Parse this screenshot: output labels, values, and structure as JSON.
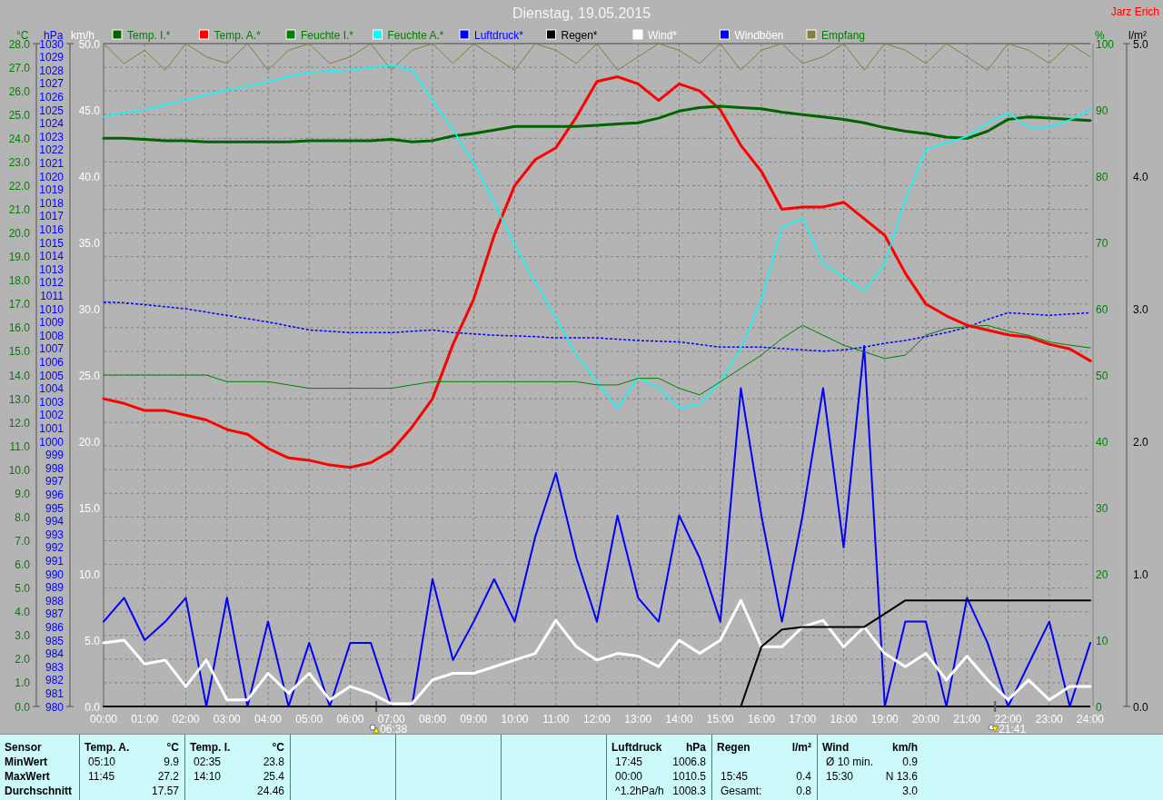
{
  "header": {
    "title": "Dienstag, 19.05.2015",
    "author": "Jarz Erich"
  },
  "charts": [
    {
      "chart_data": {
        "type": "line",
        "ylabel": "°C",
        "grid": true,
        "legend": "top",
        "x": [
          0,
          0.5,
          1,
          1.5,
          2,
          2.5,
          3,
          3.5,
          4,
          4.5,
          5,
          5.5,
          6,
          6.5,
          7,
          7.5,
          8,
          8.5,
          9,
          9.5,
          10,
          10.5,
          11,
          11.5,
          12,
          12.5,
          13,
          13.5,
          14,
          14.5,
          15,
          15.5,
          16,
          16.5,
          17,
          17.5,
          18,
          18.5,
          19,
          19.5,
          20,
          20.5,
          21,
          21.5,
          22,
          22.5,
          23,
          23.5,
          24
        ],
        "xlim": [
          0,
          24
        ],
        "xticks": [
          {
            "value": 0,
            "label": "00:00"
          },
          {
            "value": 1,
            "label": "01:00"
          },
          {
            "value": 2,
            "label": "02:00"
          },
          {
            "value": 3,
            "label": "03:00"
          },
          {
            "value": 4,
            "label": "04:00"
          },
          {
            "value": 5,
            "label": "05:00"
          },
          {
            "value": 6,
            "label": "06:00"
          },
          {
            "value": 7,
            "label": "07:00"
          },
          {
            "value": 8,
            "label": "08:00"
          },
          {
            "value": 9,
            "label": "09:00"
          },
          {
            "value": 10,
            "label": "10:00"
          },
          {
            "value": 11,
            "label": "11:00"
          },
          {
            "value": 12,
            "label": "12:00"
          },
          {
            "value": 13,
            "label": "13:00"
          },
          {
            "value": 14,
            "label": "14:00"
          },
          {
            "value": 15,
            "label": "15:00"
          },
          {
            "value": 16,
            "label": "16:00"
          },
          {
            "value": 17,
            "label": "17:00"
          },
          {
            "value": 18,
            "label": "18:00"
          },
          {
            "value": 19,
            "label": "19:00"
          },
          {
            "value": 20,
            "label": "20:00"
          },
          {
            "value": 21,
            "label": "21:00"
          },
          {
            "value": 22,
            "label": "22:00"
          },
          {
            "value": 23,
            "label": "23:00"
          },
          {
            "value": 24,
            "label": "24:00"
          }
        ],
        "ylim": [
          0,
          28
        ],
        "yticks": [
          {
            "value": 0,
            "label": "0.0"
          },
          {
            "value": 1,
            "label": "1.0"
          },
          {
            "value": 2,
            "label": "2.0"
          },
          {
            "value": 3,
            "label": "3.0"
          },
          {
            "value": 4,
            "label": "4.0"
          },
          {
            "value": 5,
            "label": "5.0"
          },
          {
            "value": 6,
            "label": "6.0"
          },
          {
            "value": 7,
            "label": "7.0"
          },
          {
            "value": 8,
            "label": "8.0"
          },
          {
            "value": 9,
            "label": "9.0"
          },
          {
            "value": 10,
            "label": "10.0"
          },
          {
            "value": 11,
            "label": "11.0"
          },
          {
            "value": 12,
            "label": "12.0"
          },
          {
            "value": 13,
            "label": "13.0"
          },
          {
            "value": 14,
            "label": "14.0"
          },
          {
            "value": 15,
            "label": "15.0"
          },
          {
            "value": 16,
            "label": "16.0"
          },
          {
            "value": 17,
            "label": "17.0"
          },
          {
            "value": 18,
            "label": "18.0"
          },
          {
            "value": 19,
            "label": "19.0"
          },
          {
            "value": 20,
            "label": "20.0"
          },
          {
            "value": 21,
            "label": "21.0"
          },
          {
            "value": 22,
            "label": "22.0"
          },
          {
            "value": 23,
            "label": "23.0"
          },
          {
            "value": 24,
            "label": "24.0"
          },
          {
            "value": 25,
            "label": "25.0"
          },
          {
            "value": 26,
            "label": "26.0"
          },
          {
            "value": 27,
            "label": "27.0"
          },
          {
            "value": 28,
            "label": "28.0"
          }
        ],
        "y2label": "hPa",
        "y2lim": [
          980,
          1030
        ],
        "y2ticks": [
          980,
          981,
          982,
          983,
          984,
          985,
          986,
          987,
          988,
          989,
          990,
          991,
          992,
          993,
          994,
          995,
          996,
          997,
          998,
          999,
          1000,
          1001,
          1002,
          1003,
          1004,
          1005,
          1006,
          1007,
          1008,
          1009,
          1010,
          1011,
          1012,
          1013,
          1014,
          1015,
          1016,
          1017,
          1018,
          1019,
          1020,
          1021,
          1022,
          1023,
          1024,
          1025,
          1026,
          1027,
          1028,
          1029,
          1030
        ],
        "y3label": "km/h",
        "y3lim": [
          0,
          50
        ],
        "y3ticks": [
          {
            "value": 0,
            "label": "0.0"
          },
          {
            "value": 5,
            "label": "5.0"
          },
          {
            "value": 10,
            "label": "10.0"
          },
          {
            "value": 15,
            "label": "15.0"
          },
          {
            "value": 20,
            "label": "20.0"
          },
          {
            "value": 25,
            "label": "25.0"
          },
          {
            "value": 30,
            "label": "30.0"
          },
          {
            "value": 35,
            "label": "35.0"
          },
          {
            "value": 40,
            "label": "40.0"
          },
          {
            "value": 45,
            "label": "45.0"
          },
          {
            "value": 50,
            "label": "50.0"
          }
        ],
        "series": [
          {
            "name": "Temp. I.*",
            "color": "#006400",
            "values": [
              24.0,
              24.0,
              23.95,
              23.9,
              23.9,
              23.85,
              23.85,
              23.85,
              23.85,
              23.85,
              23.9,
              23.9,
              23.9,
              23.9,
              23.95,
              23.85,
              23.9,
              24.1,
              24.2,
              24.35,
              24.5,
              24.5,
              24.5,
              24.5,
              24.55,
              24.6,
              24.65,
              24.85,
              25.15,
              25.3,
              25.35,
              25.3,
              25.25,
              25.1,
              25.0,
              24.9,
              24.8,
              24.65,
              24.45,
              24.3,
              24.2,
              24.05,
              24.0,
              24.3,
              24.8,
              24.9,
              24.85,
              24.8,
              24.75
            ]
          },
          {
            "name": "Temp. A.*",
            "color": "#ff0000",
            "values": [
              13.0,
              12.8,
              12.5,
              12.5,
              12.3,
              12.1,
              11.7,
              11.5,
              10.9,
              10.5,
              10.4,
              10.2,
              10.1,
              10.3,
              10.8,
              11.8,
              13.0,
              15.3,
              17.2,
              19.9,
              22.0,
              23.1,
              23.6,
              24.9,
              26.4,
              26.6,
              26.3,
              25.6,
              26.3,
              26.0,
              25.2,
              23.7,
              22.6,
              21.0,
              21.1,
              21.1,
              21.3,
              20.6,
              19.9,
              18.3,
              17.0,
              16.5,
              16.1,
              15.9,
              15.7,
              15.6,
              15.3,
              15.1,
              14.6
            ]
          },
          {
            "name": "Luftdruck*",
            "color": "#0000ff",
            "axis": "y2",
            "line_style": "dashed",
            "values": [
              1010.5,
              1010.45,
              1010.3,
              1010.15,
              1010.0,
              1009.75,
              1009.5,
              1009.25,
              1009.0,
              1008.7,
              1008.4,
              1008.3,
              1008.2,
              1008.2,
              1008.2,
              1008.3,
              1008.4,
              1008.2,
              1008.1,
              1008.0,
              1007.95,
              1007.9,
              1007.8,
              1007.8,
              1007.8,
              1007.7,
              1007.6,
              1007.55,
              1007.5,
              1007.3,
              1007.1,
              1007.1,
              1007.1,
              1007.0,
              1006.9,
              1006.8,
              1006.9,
              1007.1,
              1007.4,
              1007.6,
              1007.9,
              1008.2,
              1008.6,
              1009.2,
              1009.7,
              1009.6,
              1009.5,
              1009.6,
              1009.7
            ]
          },
          {
            "name": "Wind*",
            "color": "#ffffff",
            "axis": "y3",
            "values": [
              4.8,
              5.0,
              3.2,
              3.5,
              1.5,
              3.5,
              0.5,
              0.5,
              2.5,
              1.0,
              2.5,
              0.5,
              1.5,
              1.0,
              0.2,
              0.2,
              2.0,
              2.5,
              2.5,
              3.0,
              3.5,
              4.0,
              6.5,
              4.5,
              3.5,
              4.0,
              3.8,
              3.0,
              5.0,
              4.0,
              5.0,
              8.0,
              4.5,
              4.5,
              6.0,
              6.5,
              4.5,
              6.0,
              4.0,
              3.0,
              4.0,
              2.0,
              3.8,
              2.0,
              0.5,
              2.0,
              0.5,
              1.5,
              1.5
            ]
          },
          {
            "name": "Windböen",
            "color": "#0000ff",
            "axis": "y3",
            "values": [
              6.4,
              8.2,
              5.0,
              6.4,
              8.2,
              0,
              8.2,
              0,
              6.4,
              0,
              4.8,
              0,
              4.8,
              4.8,
              0,
              0,
              9.6,
              3.5,
              6.4,
              9.6,
              6.4,
              12.8,
              17.6,
              11.2,
              6.4,
              14.4,
              8.2,
              6.4,
              14.4,
              11.2,
              6.4,
              24,
              14.4,
              6.4,
              14.4,
              24,
              12,
              27.2,
              0,
              6.4,
              6.4,
              0,
              8.2,
              4.8,
              0,
              3.2,
              6.4,
              0,
              4.8
            ]
          }
        ]
      },
      "day_markers": [
        {
          "kind": "sunrise",
          "time": "06:38"
        },
        {
          "kind": "sunset",
          "time": "21:41"
        }
      ]
    },
    {
      "chart_data": {
        "type": "line",
        "ylabel": "%",
        "x": [
          0,
          0.5,
          1,
          1.5,
          2,
          2.5,
          3,
          3.5,
          4,
          4.5,
          5,
          5.5,
          6,
          6.5,
          7,
          7.5,
          8,
          8.5,
          9,
          9.5,
          10,
          10.5,
          11,
          11.5,
          12,
          12.5,
          13,
          13.5,
          14,
          14.5,
          15,
          15.5,
          16,
          16.5,
          17,
          17.5,
          18,
          18.5,
          19,
          19.5,
          20,
          20.5,
          21,
          21.5,
          22,
          22.5,
          23,
          23.5,
          24
        ],
        "xlim": [
          0,
          24
        ],
        "ylim": [
          0,
          100
        ],
        "yticks": [
          0,
          10,
          20,
          30,
          40,
          50,
          60,
          70,
          80,
          90,
          100
        ],
        "y2label": "l/m²",
        "y2lim": [
          0,
          5
        ],
        "y2ticks": [
          {
            "value": 0,
            "label": "0.0"
          },
          {
            "value": 1,
            "label": "1.0"
          },
          {
            "value": 2,
            "label": "2.0"
          },
          {
            "value": 3,
            "label": "3.0"
          },
          {
            "value": 4,
            "label": "4.0"
          },
          {
            "value": 5,
            "label": "5.0"
          }
        ],
        "series": [
          {
            "name": "Feuchte I.*",
            "color": "#008000",
            "values": [
              50,
              50,
              50,
              50,
              50,
              50,
              49,
              49,
              49,
              48.5,
              48,
              48,
              48,
              48,
              48,
              48.5,
              49,
              49,
              49,
              49,
              49,
              49,
              49,
              49,
              48.5,
              48.5,
              49.5,
              49.5,
              48,
              47,
              49,
              51,
              53,
              55.5,
              57.5,
              56,
              54.5,
              53.5,
              52.5,
              53,
              56,
              57,
              57.3,
              57.5,
              56.6,
              56,
              55,
              54.5,
              54.1
            ]
          },
          {
            "name": "Feuchte A.*",
            "color": "#00ffff",
            "values": [
              89,
              89.5,
              90,
              90.8,
              91.5,
              92.3,
              93,
              93.6,
              94.2,
              95,
              95.6,
              95.8,
              96,
              96.4,
              96.7,
              96,
              91.5,
              87,
              82,
              76,
              69.6,
              64,
              58.6,
              53,
              49,
              45,
              49.7,
              48,
              45,
              45.6,
              49,
              54,
              61.4,
              72.3,
              73.7,
              66.8,
              64.8,
              62.7,
              66.8,
              76.4,
              84,
              85,
              86,
              88,
              89.5,
              87.4,
              87.4,
              88.5,
              90
            ]
          },
          {
            "name": "Regen*",
            "color": "#000000",
            "axis": "y2",
            "values": [
              0,
              0,
              0,
              0,
              0,
              0,
              0,
              0,
              0,
              0,
              0,
              0,
              0,
              0,
              0,
              0,
              0,
              0,
              0,
              0,
              0,
              0,
              0,
              0,
              0,
              0,
              0,
              0,
              0,
              0,
              0,
              0,
              0.45,
              0.58,
              0.6,
              0.6,
              0.6,
              0.6,
              0.7,
              0.8,
              0.8,
              0.8,
              0.8,
              0.8,
              0.8,
              0.8,
              0.8,
              0.8,
              0.8
            ]
          },
          {
            "name": "Empfang",
            "color": "#808040",
            "values": [
              100,
              97,
              99,
              96,
              100,
              98,
              97,
              100,
              96,
              99,
              100,
              97,
              98,
              100,
              96,
              99,
              100,
              97,
              100,
              98,
              96,
              100,
              99,
              97,
              100,
              96,
              98,
              100,
              99,
              97,
              100,
              96,
              99,
              100,
              97,
              98,
              100,
              96,
              100,
              99,
              97,
              100,
              98,
              96,
              100,
              99,
              97,
              100,
              98
            ]
          }
        ]
      }
    }
  ],
  "summary": {
    "header": "Sensor",
    "row_labels": [
      "MinWert",
      "MaxWert",
      "Durchschnitt"
    ],
    "sensors": [
      {
        "kind": "sensor",
        "name": "Temp. A.",
        "unit": "°C",
        "rows": [
          {
            "time": "05:10",
            "value": "9.9"
          },
          {
            "time": "11:45",
            "value": "27.2"
          },
          {
            "value": "17.57"
          }
        ]
      },
      {
        "kind": "sensor",
        "name": "Temp. I.",
        "unit": "°C",
        "rows": [
          {
            "time": "02:35",
            "value": "23.8"
          },
          {
            "time": "14:10",
            "value": "25.4"
          },
          {
            "value": "24.46"
          }
        ]
      },
      {
        "kind": "blank"
      },
      {
        "kind": "blank"
      },
      {
        "kind": "blank"
      },
      {
        "kind": "sensor",
        "name": "Luftdruck",
        "unit": "hPa",
        "rows": [
          {
            "time": "17:45",
            "value": "1006.8"
          },
          {
            "time": "00:00",
            "value": "1010.5"
          },
          {
            "time": "^1.2hPa/h",
            "value": "1008.3"
          }
        ]
      },
      {
        "kind": "sensor",
        "name": "Regen",
        "unit": "l/m²",
        "rows": [
          {},
          {
            "time": "15:45",
            "value": "0.4"
          },
          {
            "time": "Gesamt:",
            "value": "0.8"
          }
        ]
      },
      {
        "kind": "sensor",
        "name": "Wind",
        "unit": "km/h",
        "rows": [
          {
            "time": "Ø 10 min.",
            "value": "0.9"
          },
          {
            "time": "15:30",
            "value": "N 13.6"
          },
          {
            "value": "3.0"
          }
        ]
      }
    ]
  }
}
